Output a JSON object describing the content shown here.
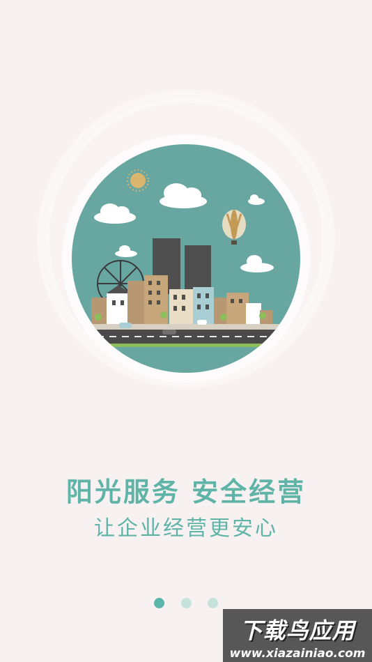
{
  "headline": "阳光服务  安全经营",
  "subheadline": "让企业经营更安心",
  "pagination": {
    "total": 3,
    "active_index": 0
  },
  "illustration": {
    "name": "city-skyline-illustration"
  },
  "watermark": {
    "title": "下载鸟应用",
    "url": "www.xiazainiao.com"
  },
  "colors": {
    "background": "#f7f2f1",
    "accent": "#5fb3a7",
    "sky": "#68a7a1",
    "dot_inactive": "#c6e2dd"
  }
}
